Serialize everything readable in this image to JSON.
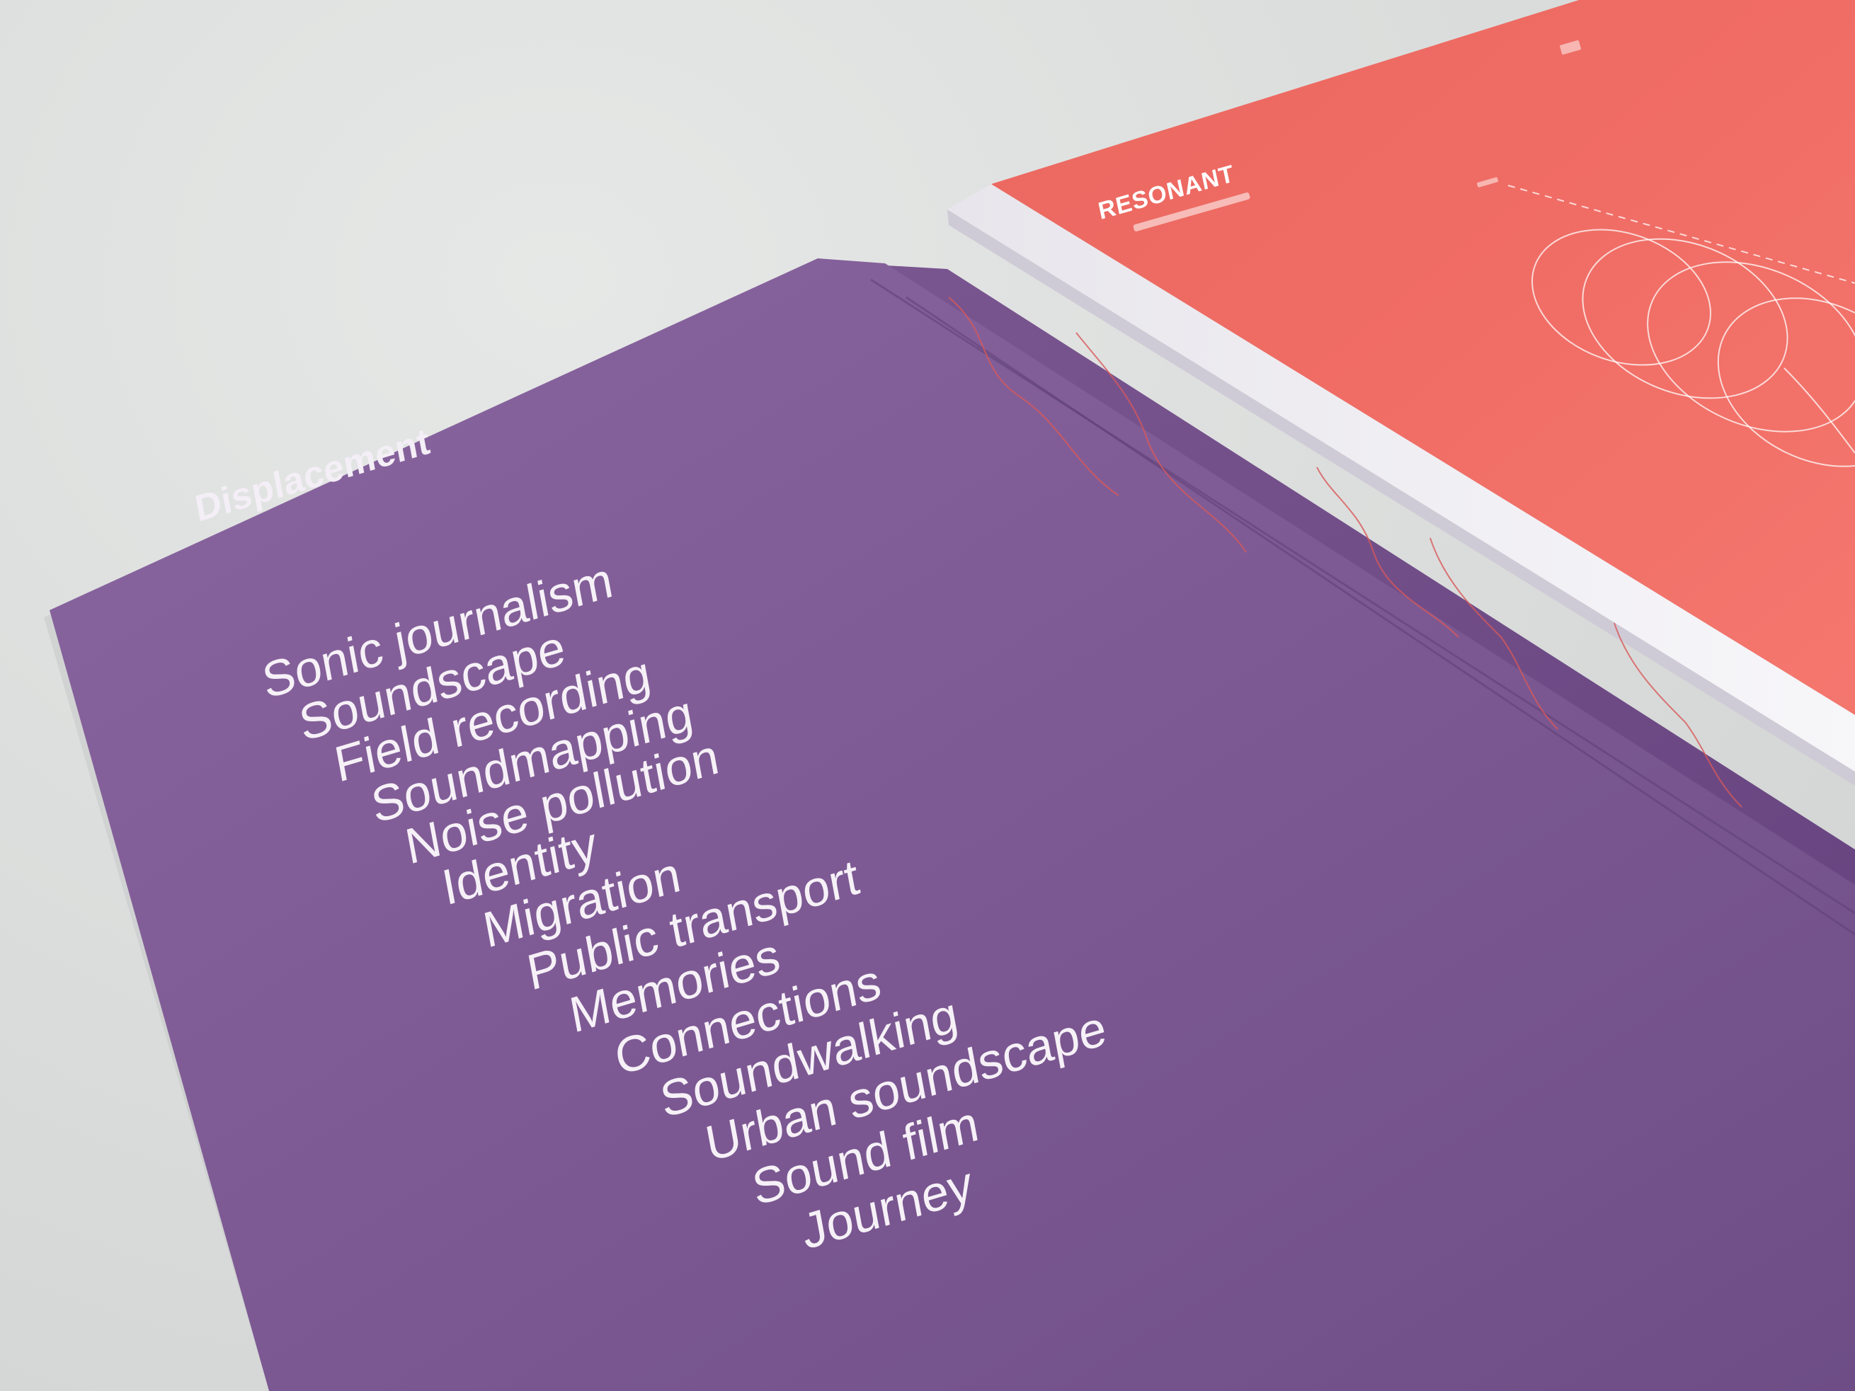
{
  "folder": {
    "heading": "Displacement",
    "terms": [
      "Sonic journalism",
      "Soundscape",
      "Field recording",
      "Soundmapping",
      "Noise pollution",
      "Identity",
      "Migration",
      "Public transport",
      "Memories",
      "Connections",
      "Soundwalking",
      "Urban soundscape",
      "Sound film",
      "Journey"
    ]
  },
  "booklet": {
    "title": "RESONANT"
  },
  "colors": {
    "background": "#dcdedd",
    "folder_purple": "#7e5a94",
    "folder_dark": "#6c4a82",
    "booklet_red": "#ee6b63",
    "spine_white": "#f1eff4",
    "text_light": "#f6f1f7"
  }
}
